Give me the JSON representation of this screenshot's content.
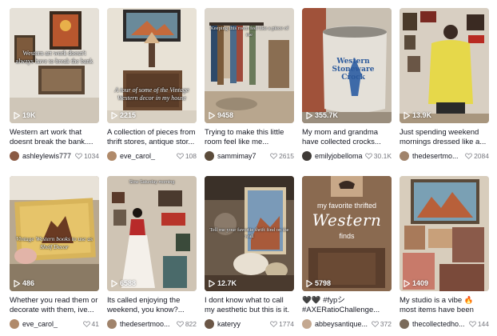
{
  "colors": {
    "text": "#161823",
    "muted": "#8a8b91",
    "white": "#ffffff"
  },
  "icons": {
    "views": "play-icon",
    "likes": "heart-outline-icon"
  },
  "videos": [
    {
      "views": "19K",
      "caption": "Western art work that doesnt break the bank....",
      "author": "ashleylewis777",
      "likes": "1034",
      "overlay": "Western art work doesn't always have to break the bank",
      "avatar_color": "#8a5a44"
    },
    {
      "views": "2215",
      "caption": "A collection of pieces from thrift stores, antique stor...",
      "author": "eve_carol_",
      "likes": "108",
      "overlay": "A tour of some of the Vintage Western decor in my house",
      "avatar_color": "#b08a6a"
    },
    {
      "views": "9458",
      "caption": "Trying to make this little room feel like me...",
      "author": "sammimay7",
      "likes": "2615",
      "overlay": "Keeping this room feel like a piece of me",
      "avatar_color": "#5b4b3a"
    },
    {
      "views": "355.7K",
      "caption": "My mom and grandma have collected crocks...",
      "author": "emilyjobelloma",
      "likes": "30.1K",
      "overlay": "Western Stoneware Crock",
      "avatar_color": "#3e3a36"
    },
    {
      "views": "13.9K",
      "caption": "Just spending weekend mornings dressed like a...",
      "author": "thedesertmo...",
      "likes": "2084",
      "overlay": "",
      "avatar_color": "#a0836b"
    },
    {
      "views": "486",
      "caption": "Whether you read them or decorate with them, ive...",
      "author": "eve_carol_",
      "likes": "41",
      "overlay": "Vintage Western books to use as Shelf Decor",
      "avatar_color": "#b08a6a"
    },
    {
      "views": "6588",
      "caption": "Its called enjoying the weekend, you know?...",
      "author": "thedesertmoo...",
      "likes": "822",
      "overlay": "Slow Saturday morning",
      "avatar_color": "#a0836b"
    },
    {
      "views": "12.7K",
      "caption": "I dont know what to call my aesthetic but this is it. Lm...",
      "author": "kateryy",
      "likes": "1774",
      "overlay": "Tell me your favorite thrift find on the wall",
      "avatar_color": "#6b5646"
    },
    {
      "views": "5798",
      "caption": "🖤🖤 #fypシ #AXERatioChallenge...",
      "author": "abbeysantique...",
      "likes": "372",
      "overlay_small": "my favorite thrifted",
      "overlay_big": "Western",
      "overlay_sub": "finds",
      "avatar_color": "#c4a890"
    },
    {
      "views": "1409",
      "caption": "My studio is a vibe 🔥 most items have been thrifted,...",
      "author": "thecollectedho...",
      "likes": "144",
      "overlay": "",
      "avatar_color": "#7a6a5a"
    }
  ]
}
